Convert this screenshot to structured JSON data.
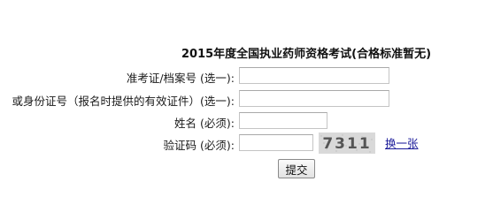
{
  "form": {
    "title": "2015年度全国执业药师资格考试(合格标准暂无)",
    "fields": [
      {
        "label": "准考证/档案号 (选一):",
        "value": ""
      },
      {
        "label": "或身份证号（报名时提供的有效证件）(选一):",
        "value": ""
      },
      {
        "label": "姓名 (必须):",
        "value": ""
      },
      {
        "label": "验证码 (必须):",
        "value": ""
      }
    ],
    "captcha": {
      "text": "7311"
    },
    "refresh_link": "换一张",
    "submit_label": "提交"
  }
}
